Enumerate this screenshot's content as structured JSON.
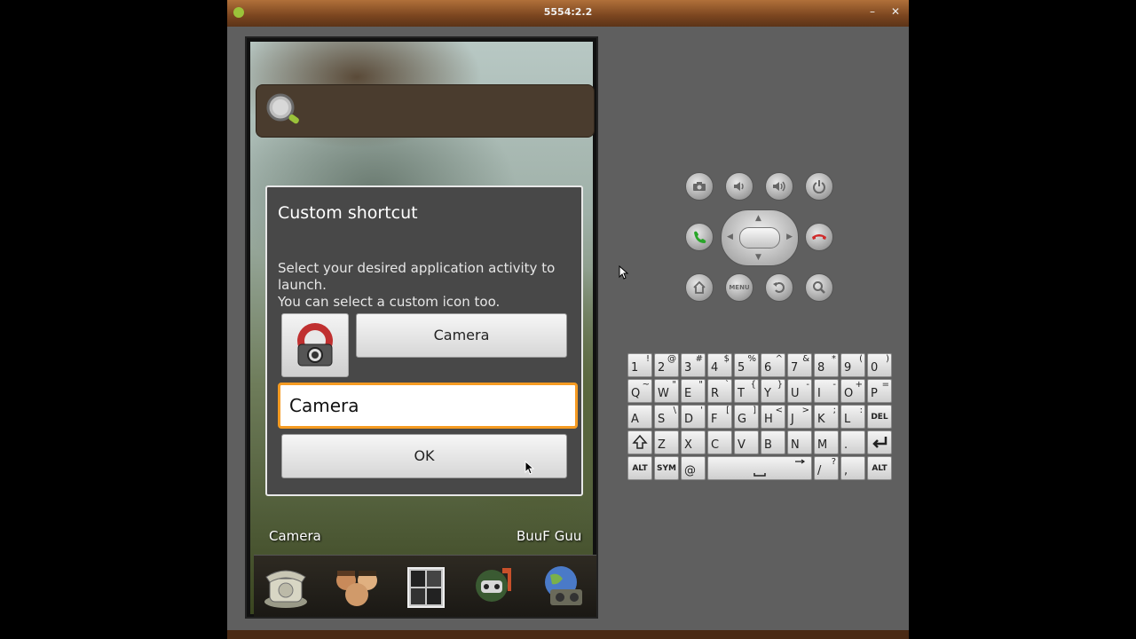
{
  "window": {
    "title": "5554:2.2",
    "minimize_glyph": "–",
    "close_glyph": "✕"
  },
  "launcher": {
    "search_icon": "magnifier-icon",
    "desktop_labels": [
      "Camera",
      "BuuF Guu"
    ],
    "dock_icons": [
      "phone-icon",
      "contacts-icon",
      "app-drawer-icon",
      "browser-icon",
      "globe-camera-icon"
    ]
  },
  "dialog": {
    "title": "Custom shortcut",
    "message_line1": "Select your desired application activity to launch.",
    "message_line2": "You can select a custom icon too.",
    "activity_button": "Camera",
    "name_value": "Camera",
    "ok_button": "OK",
    "accent_color": "#f59b22"
  },
  "controls": {
    "menu_label": "MENU",
    "call_color": "#2aa52a",
    "endcall_color": "#d02a2a"
  },
  "keyboard": {
    "row1": [
      [
        "1",
        "!"
      ],
      [
        "2",
        "@"
      ],
      [
        "3",
        "#"
      ],
      [
        "4",
        "$"
      ],
      [
        "5",
        "%"
      ],
      [
        "6",
        "^"
      ],
      [
        "7",
        "&"
      ],
      [
        "8",
        "*"
      ],
      [
        "9",
        "("
      ],
      [
        "0",
        ")"
      ]
    ],
    "row2": [
      [
        "Q",
        "~"
      ],
      [
        "W",
        "\""
      ],
      [
        "E",
        "\""
      ],
      [
        "R",
        "`"
      ],
      [
        "T",
        "{"
      ],
      [
        "Y",
        "}"
      ],
      [
        "U",
        "-"
      ],
      [
        "I",
        "-"
      ],
      [
        "O",
        "+"
      ],
      [
        "P",
        "="
      ]
    ],
    "row3": [
      [
        "A",
        ""
      ],
      [
        "S",
        "\\"
      ],
      [
        "D",
        "'"
      ],
      [
        "F",
        "["
      ],
      [
        "G",
        "]"
      ],
      [
        "H",
        "<"
      ],
      [
        "J",
        ">"
      ],
      [
        "K",
        ";"
      ],
      [
        "L",
        ":"
      ]
    ],
    "row3_del": "DEL",
    "row4": [
      [
        "Z",
        ""
      ],
      [
        "X",
        ""
      ],
      [
        "C",
        ""
      ],
      [
        "V",
        ""
      ],
      [
        "B",
        ""
      ],
      [
        "N",
        ""
      ],
      [
        "M",
        ""
      ],
      [
        ".",
        ""
      ]
    ],
    "row5_alt_left": "ALT",
    "row5_sym": "SYM",
    "row5_at": "@",
    "row5_slash": [
      "/",
      "?"
    ],
    "row5_comma": ",",
    "row5_alt_right": "ALT"
  }
}
